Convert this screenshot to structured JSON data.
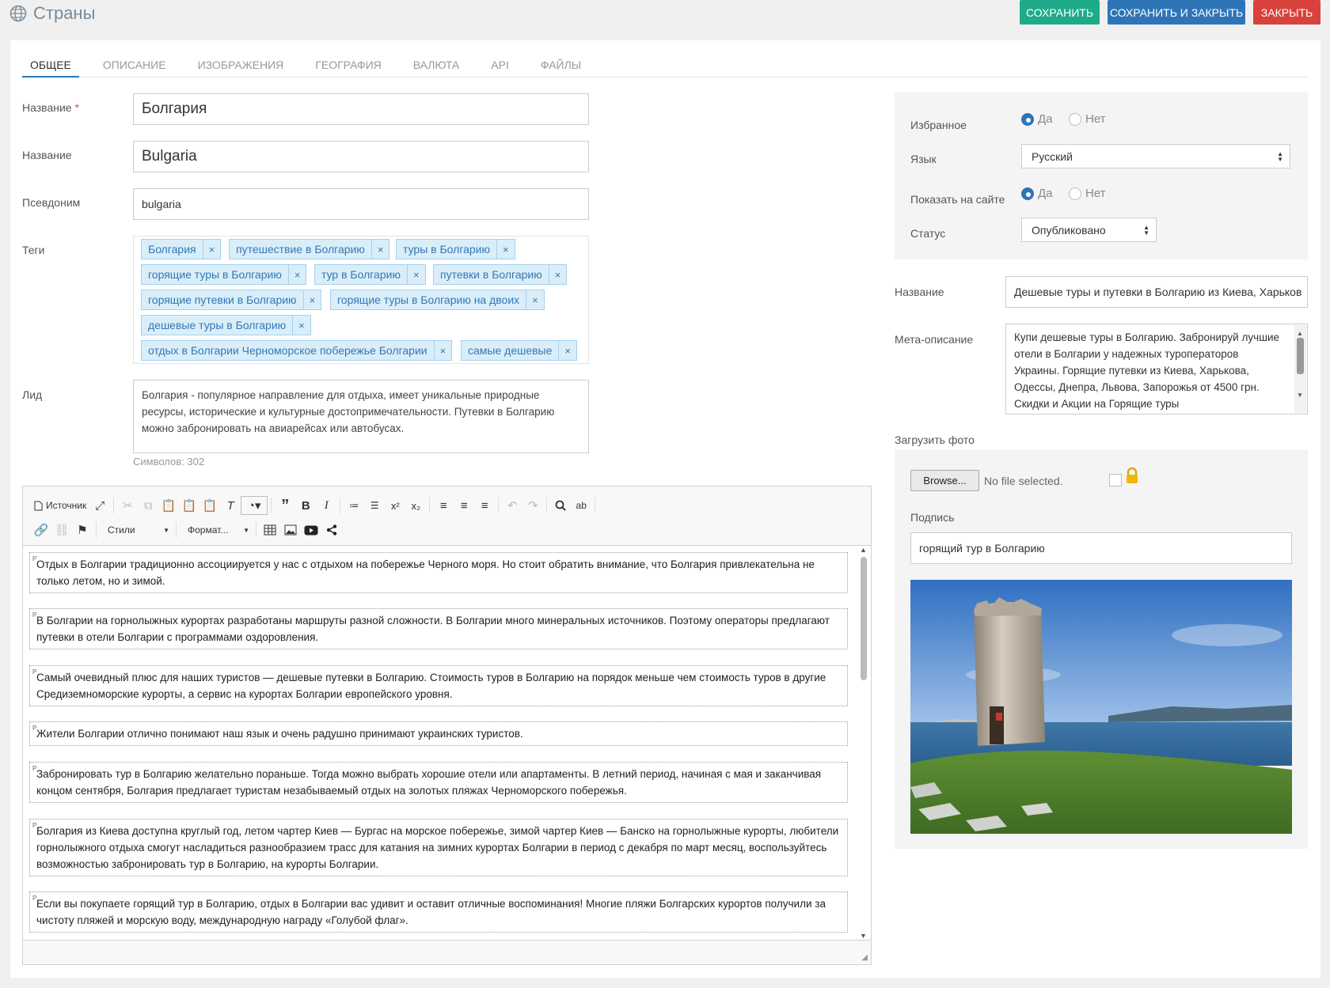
{
  "header": {
    "title": "Страны",
    "buttons": {
      "save": "Сохранить",
      "save_close": "Сохранить и закрыть",
      "close": "Закрыть"
    }
  },
  "tabs": [
    "Общее",
    "Описание",
    "Изображения",
    "География",
    "Валюта",
    "API",
    "Файлы"
  ],
  "form": {
    "name_label": "Название",
    "name_required_mark": "*",
    "name_value": "Болгария",
    "name_en_label": "Название",
    "name_en_value": "Bulgaria",
    "alias_label": "Псевдоним",
    "alias_value": "bulgaria",
    "tags_label": "Теги",
    "tag_remove": "×",
    "tags": [
      "Болгария",
      "путешествие в Болгарию",
      "туры в Болгарию",
      "горящие туры в Болгарию",
      "тур в Болгарию",
      "путевки в Болгарию",
      "горящие путевки в Болгарию",
      "горящие туры в Болгарию на двоих",
      "дешевые туры в Болгарию",
      "отдых в Болгарии Черноморское побережье Болгарии",
      "самые дешевые"
    ],
    "lead_label": "Лид",
    "lead_value": "Болгария - популярное направление для отдыха, имеет уникальные природные ресурсы, исторические и культурные достопримечательности. Путевки в Болгарию можно забронировать на авиарейсах или автобусах.",
    "counter": "Символов: 302"
  },
  "editor": {
    "source_label": "Источник",
    "styles_label": "Стили",
    "format_label": "Формат...",
    "paragraph_marker": "P",
    "paragraphs": [
      "Отдых в Болгарии традиционно ассоциируется у нас с отдыхом на побережье Черного моря. Но стоит обратить внимание, что Болгария привлекательна не только летом, но и зимой.",
      "В Болгарии на горнолыжных курортах разработаны маршруты разной сложности. В Болгарии много минеральных источников. Поэтому операторы предлагают путевки в отели Болгарии с программами оздоровления.",
      "Самый очевидный плюс для наших туристов — дешевые путевки в Болгарию. Стоимость туров в Болгарию на порядок меньше чем стоимость туров в другие Средиземноморские курорты, а сервис на курортах Болгарии европейского уровня.",
      "Жители Болгарии отлично понимают наш язык и очень радушно принимают украинских туристов.",
      "Забронировать тур в Болгарию желательно пораньше. Тогда можно выбрать хорошие отели или апартаменты. В летний период, начиная с мая и заканчивая концом сентября, Болгария предлагает туристам незабываемый отдых на золотых пляжах Черноморского побережья.",
      "Болгария из Киева доступна круглый год, летом чартер Киев — Бургас на морское побережье, зимой чартер Киев — Банско на горнолыжные курорты, любители горнолыжного отдыха смогут насладиться разнообразием трасс для катания на зимних курортах Болгарии в период с декабря по март месяц, воспользуйтесь возможностью забронировать тур в Болгарию, на курорты Болгарии.",
      "Если вы покупаете горящий тур в Болгарию, отдых в Болгарии вас удивит и оставит отличные воспоминания! Многие пляжи Болгарских курортов получили за чистоту пляжей и морскую воду, международную награду «Голубой флаг»."
    ]
  },
  "settings": {
    "featured_label": "Избранное",
    "yes": "Да",
    "no": "Нет",
    "language_label": "Язык",
    "language_value": "Русский",
    "show_label": "Показать на сайте",
    "status_label": "Статус",
    "status_value": "Опубликовано",
    "featured_selected": "yes",
    "show_selected": "yes"
  },
  "seo": {
    "title_label": "Название",
    "title_value": "Дешевые туры и путевки в Болгарию из Киева, Харьков",
    "meta_label": "Мета-описание",
    "meta_value": "Купи дешевые туры в Болгарию. Забронируй лучшие отели в Болгарии у надежных туроператоров Украины. Горящие путевки из Киева, Харькова, Одессы, Днепра, Львова, Запорожья от 4500 грн. Скидки и Акции на Горящие туры"
  },
  "upload": {
    "label": "Загрузить фото",
    "browse": "Browse...",
    "no_file": "No file selected.",
    "caption_label": "Подпись",
    "caption_value": "горящий тур в Болгарию"
  },
  "colors": {
    "save": "#1eab89",
    "save_close": "#2e75b7",
    "close": "#d9413d",
    "tag_bg": "#d9eef9",
    "tag_text": "#3478b5"
  }
}
